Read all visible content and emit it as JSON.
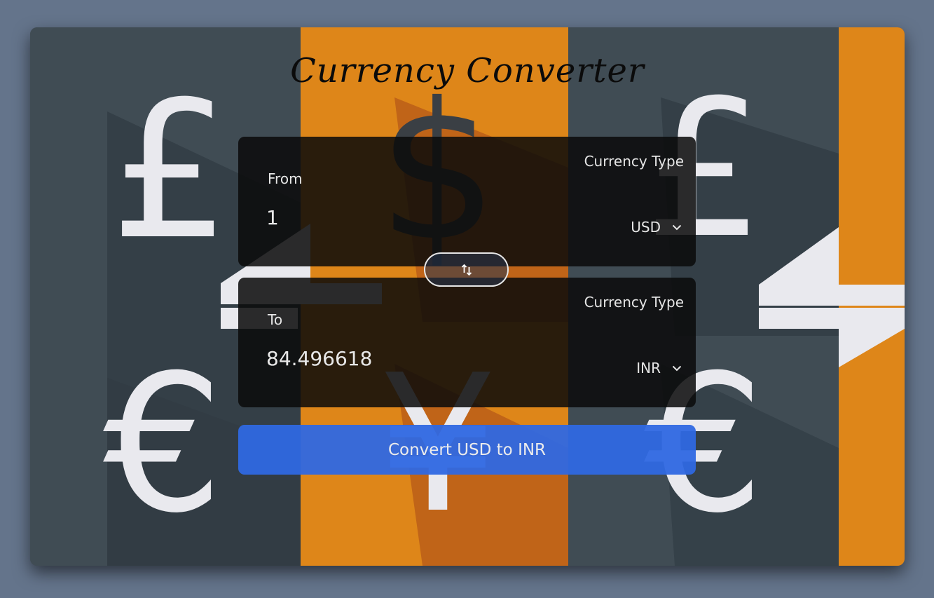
{
  "app": {
    "title": "Currency Converter"
  },
  "from": {
    "label": "From",
    "amount": "1",
    "currency_type_label": "Currency Type",
    "currency": "USD"
  },
  "to": {
    "label": "To",
    "amount": "84.496618",
    "currency_type_label": "Currency Type",
    "currency": "INR"
  },
  "swap": {
    "icon": "swap-vertical-arrows-icon"
  },
  "convert_button": {
    "label": "Convert USD to INR"
  },
  "background": {
    "symbols": [
      "£",
      "$",
      "£",
      "€",
      "¥",
      "€"
    ],
    "colors": {
      "slate": "#404c54",
      "slate_dark": "#2f3a42",
      "orange": "#de8619",
      "orange_dark": "#c06418",
      "symbol": "#e9e9ee"
    }
  },
  "colors": {
    "page_bg": "#64748b",
    "panel_bg": "#0a0a0a",
    "button_blue": "#2f68e2",
    "text": "#e6e6e6"
  }
}
